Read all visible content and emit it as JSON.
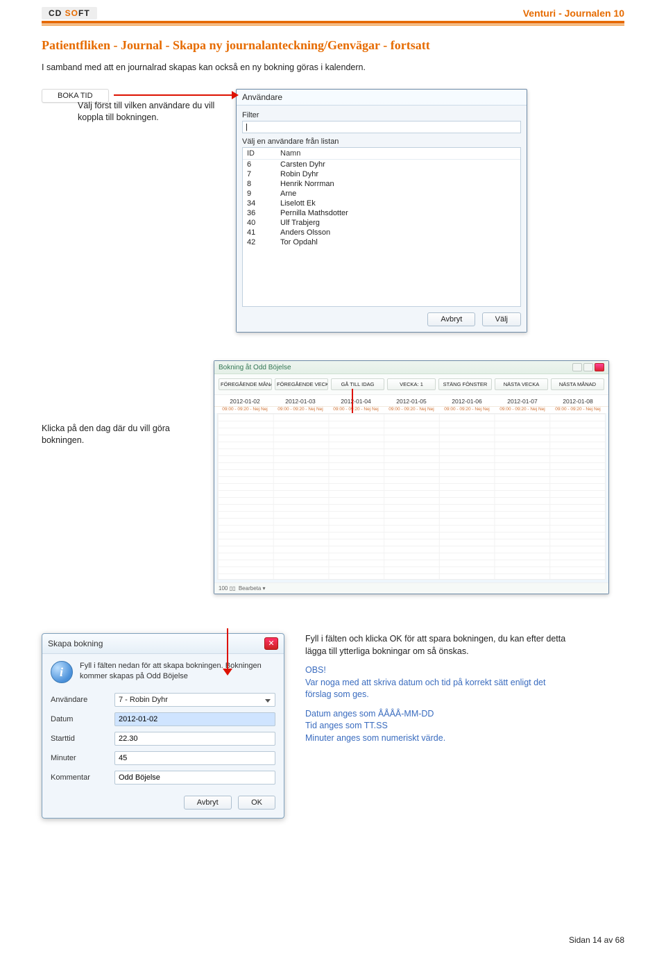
{
  "header": {
    "logo_cd": "CD ",
    "logo_so": "SO",
    "logo_ft": "FT",
    "right": "Venturi - Journalen 10"
  },
  "title": "Patientfliken - Journal - Skapa ny journalanteckning/Genvägar - fortsatt",
  "intro": "I samband med att en journalrad skapas kan också en ny bokning göras i kalendern.",
  "boka_btn": "BOKA TID",
  "hint1": "Välj först till vilken användare du vill koppla till bokningen.",
  "hint2": "Klicka på den dag där du vill göra bokningen.",
  "userpicker": {
    "title": "Användare",
    "filter_label": "Filter",
    "filter_value": "|",
    "list_label": "Välj en användare från listan",
    "cols": {
      "id": "ID",
      "name": "Namn"
    },
    "rows": [
      {
        "id": "6",
        "name": "Carsten Dyhr"
      },
      {
        "id": "7",
        "name": "Robin Dyhr"
      },
      {
        "id": "8",
        "name": "Henrik Norrman"
      },
      {
        "id": "9",
        "name": "Arne"
      },
      {
        "id": "34",
        "name": "Liselott Ek"
      },
      {
        "id": "36",
        "name": "Pernilla Mathsdotter"
      },
      {
        "id": "40",
        "name": "Ulf Trabjerg"
      },
      {
        "id": "41",
        "name": "Anders Olsson"
      },
      {
        "id": "42",
        "name": "Tor Opdahl"
      }
    ],
    "cancel": "Avbryt",
    "ok": "Välj"
  },
  "cal": {
    "title": "Bokning åt Odd Böjelse",
    "nav": [
      "FÖREGÅENDE MÅNAD",
      "FÖREGÅENDE VECKA",
      "GÅ TILL IDAG",
      "VECKA: 1",
      "STÄNG FÖNSTER",
      "NÄSTA VECKA",
      "NÄSTA MÅNAD"
    ],
    "days": [
      "2012-01-02",
      "2012-01-03",
      "2012-01-04",
      "2012-01-05",
      "2012-01-06",
      "2012-01-07",
      "2012-01-08"
    ],
    "hours": "09:00 - 09:20 - Nej Nej",
    "footer_zoom": "100",
    "footer_edit": "Bearbeta"
  },
  "dlg": {
    "title": "Skapa bokning",
    "intro": "Fyll i fälten nedan för att skapa bokningen. Bokningen kommer skapas på Odd Böjelse",
    "labels": {
      "user": "Användare",
      "date": "Datum",
      "start": "Starttid",
      "min": "Minuter",
      "comment": "Kommentar"
    },
    "values": {
      "user": "7 - Robin Dyhr",
      "date": "2012-01-02",
      "start": "22.30",
      "min": "45",
      "comment": "Odd Böjelse"
    },
    "cancel": "Avbryt",
    "ok": "OK"
  },
  "sidehints": {
    "p1": "Fyll i fälten och klicka OK för att spara bokningen, du kan efter detta lägga till ytterliga bokningar om så önskas.",
    "p2a": "OBS!",
    "p2b": "Var noga med att skriva datum och tid på korrekt sätt enligt det förslag som ges.",
    "p3": "Datum anges som ÅÅÅÅ-MM-DD\nTid anges som TT.SS\nMinuter anges som numeriskt värde."
  },
  "footer": {
    "page": "Sidan 14 av 68"
  }
}
